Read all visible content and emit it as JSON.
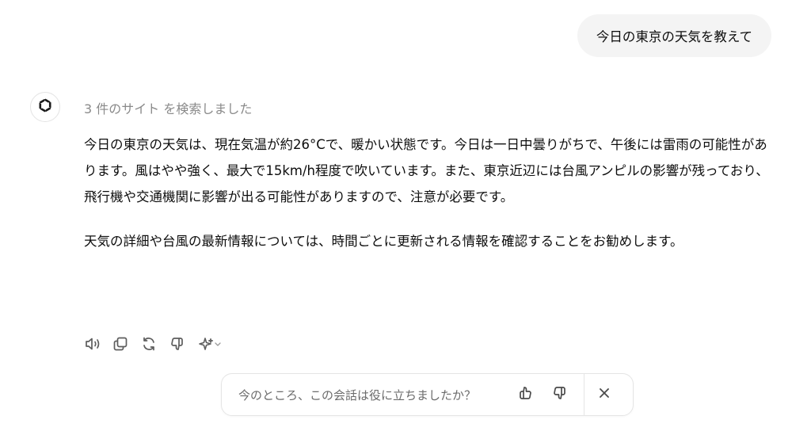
{
  "user_message": "今日の東京の天気を教えて",
  "assistant": {
    "avatar_icon": "openai-logo-icon",
    "sources_label": "3 件のサイト を検索しました",
    "paragraphs": [
      "今日の東京の天気は、現在気温が約26°Cで、暖かい状態です。今日は一日中曇りがちで、午後には雷雨の可能性があります。風はやや強く、最大で15km/h程度で吹いています。また、東京近辺には台風アンピルの影響が残っており、飛行機や交通機関に影響が出る可能性がありますので、注意が必要です。",
      "天気の詳細や台風の最新情報については、時間ごとに更新される情報を確認することをお勧めします。"
    ],
    "actions": [
      {
        "icon": "speaker-icon"
      },
      {
        "icon": "copy-icon"
      },
      {
        "icon": "regenerate-icon"
      },
      {
        "icon": "thumbs-down-icon"
      },
      {
        "icon": "sparkle-model-icon"
      }
    ]
  },
  "feedback": {
    "prompt": "今のところ、この会話は役に立ちましたか？",
    "icons": [
      "thumbs-up-icon",
      "thumbs-down-icon",
      "close-icon"
    ]
  },
  "colors": {
    "bubble_bg": "#f4f4f4",
    "muted_text": "#8a8a8a",
    "icon": "#5d5d5d"
  }
}
